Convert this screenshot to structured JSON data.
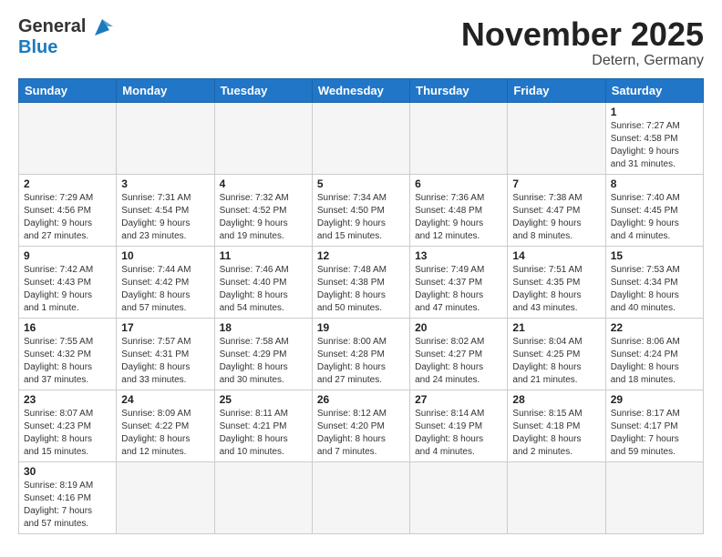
{
  "header": {
    "logo_general": "General",
    "logo_blue": "Blue",
    "month_title": "November 2025",
    "location": "Detern, Germany"
  },
  "weekdays": [
    "Sunday",
    "Monday",
    "Tuesday",
    "Wednesday",
    "Thursday",
    "Friday",
    "Saturday"
  ],
  "days": [
    {
      "num": "",
      "info": "",
      "empty": true
    },
    {
      "num": "",
      "info": "",
      "empty": true
    },
    {
      "num": "",
      "info": "",
      "empty": true
    },
    {
      "num": "",
      "info": "",
      "empty": true
    },
    {
      "num": "",
      "info": "",
      "empty": true
    },
    {
      "num": "",
      "info": "",
      "empty": true
    },
    {
      "num": "1",
      "info": "Sunrise: 7:27 AM\nSunset: 4:58 PM\nDaylight: 9 hours\nand 31 minutes.",
      "empty": false
    },
    {
      "num": "2",
      "info": "Sunrise: 7:29 AM\nSunset: 4:56 PM\nDaylight: 9 hours\nand 27 minutes.",
      "empty": false
    },
    {
      "num": "3",
      "info": "Sunrise: 7:31 AM\nSunset: 4:54 PM\nDaylight: 9 hours\nand 23 minutes.",
      "empty": false
    },
    {
      "num": "4",
      "info": "Sunrise: 7:32 AM\nSunset: 4:52 PM\nDaylight: 9 hours\nand 19 minutes.",
      "empty": false
    },
    {
      "num": "5",
      "info": "Sunrise: 7:34 AM\nSunset: 4:50 PM\nDaylight: 9 hours\nand 15 minutes.",
      "empty": false
    },
    {
      "num": "6",
      "info": "Sunrise: 7:36 AM\nSunset: 4:48 PM\nDaylight: 9 hours\nand 12 minutes.",
      "empty": false
    },
    {
      "num": "7",
      "info": "Sunrise: 7:38 AM\nSunset: 4:47 PM\nDaylight: 9 hours\nand 8 minutes.",
      "empty": false
    },
    {
      "num": "8",
      "info": "Sunrise: 7:40 AM\nSunset: 4:45 PM\nDaylight: 9 hours\nand 4 minutes.",
      "empty": false
    },
    {
      "num": "9",
      "info": "Sunrise: 7:42 AM\nSunset: 4:43 PM\nDaylight: 9 hours\nand 1 minute.",
      "empty": false
    },
    {
      "num": "10",
      "info": "Sunrise: 7:44 AM\nSunset: 4:42 PM\nDaylight: 8 hours\nand 57 minutes.",
      "empty": false
    },
    {
      "num": "11",
      "info": "Sunrise: 7:46 AM\nSunset: 4:40 PM\nDaylight: 8 hours\nand 54 minutes.",
      "empty": false
    },
    {
      "num": "12",
      "info": "Sunrise: 7:48 AM\nSunset: 4:38 PM\nDaylight: 8 hours\nand 50 minutes.",
      "empty": false
    },
    {
      "num": "13",
      "info": "Sunrise: 7:49 AM\nSunset: 4:37 PM\nDaylight: 8 hours\nand 47 minutes.",
      "empty": false
    },
    {
      "num": "14",
      "info": "Sunrise: 7:51 AM\nSunset: 4:35 PM\nDaylight: 8 hours\nand 43 minutes.",
      "empty": false
    },
    {
      "num": "15",
      "info": "Sunrise: 7:53 AM\nSunset: 4:34 PM\nDaylight: 8 hours\nand 40 minutes.",
      "empty": false
    },
    {
      "num": "16",
      "info": "Sunrise: 7:55 AM\nSunset: 4:32 PM\nDaylight: 8 hours\nand 37 minutes.",
      "empty": false
    },
    {
      "num": "17",
      "info": "Sunrise: 7:57 AM\nSunset: 4:31 PM\nDaylight: 8 hours\nand 33 minutes.",
      "empty": false
    },
    {
      "num": "18",
      "info": "Sunrise: 7:58 AM\nSunset: 4:29 PM\nDaylight: 8 hours\nand 30 minutes.",
      "empty": false
    },
    {
      "num": "19",
      "info": "Sunrise: 8:00 AM\nSunset: 4:28 PM\nDaylight: 8 hours\nand 27 minutes.",
      "empty": false
    },
    {
      "num": "20",
      "info": "Sunrise: 8:02 AM\nSunset: 4:27 PM\nDaylight: 8 hours\nand 24 minutes.",
      "empty": false
    },
    {
      "num": "21",
      "info": "Sunrise: 8:04 AM\nSunset: 4:25 PM\nDaylight: 8 hours\nand 21 minutes.",
      "empty": false
    },
    {
      "num": "22",
      "info": "Sunrise: 8:06 AM\nSunset: 4:24 PM\nDaylight: 8 hours\nand 18 minutes.",
      "empty": false
    },
    {
      "num": "23",
      "info": "Sunrise: 8:07 AM\nSunset: 4:23 PM\nDaylight: 8 hours\nand 15 minutes.",
      "empty": false
    },
    {
      "num": "24",
      "info": "Sunrise: 8:09 AM\nSunset: 4:22 PM\nDaylight: 8 hours\nand 12 minutes.",
      "empty": false
    },
    {
      "num": "25",
      "info": "Sunrise: 8:11 AM\nSunset: 4:21 PM\nDaylight: 8 hours\nand 10 minutes.",
      "empty": false
    },
    {
      "num": "26",
      "info": "Sunrise: 8:12 AM\nSunset: 4:20 PM\nDaylight: 8 hours\nand 7 minutes.",
      "empty": false
    },
    {
      "num": "27",
      "info": "Sunrise: 8:14 AM\nSunset: 4:19 PM\nDaylight: 8 hours\nand 4 minutes.",
      "empty": false
    },
    {
      "num": "28",
      "info": "Sunrise: 8:15 AM\nSunset: 4:18 PM\nDaylight: 8 hours\nand 2 minutes.",
      "empty": false
    },
    {
      "num": "29",
      "info": "Sunrise: 8:17 AM\nSunset: 4:17 PM\nDaylight: 7 hours\nand 59 minutes.",
      "empty": false
    },
    {
      "num": "30",
      "info": "Sunrise: 8:19 AM\nSunset: 4:16 PM\nDaylight: 7 hours\nand 57 minutes.",
      "empty": false,
      "last": true
    },
    {
      "num": "",
      "info": "",
      "empty": true,
      "last": true
    },
    {
      "num": "",
      "info": "",
      "empty": true,
      "last": true
    },
    {
      "num": "",
      "info": "",
      "empty": true,
      "last": true
    },
    {
      "num": "",
      "info": "",
      "empty": true,
      "last": true
    },
    {
      "num": "",
      "info": "",
      "empty": true,
      "last": true
    },
    {
      "num": "",
      "info": "",
      "empty": true,
      "last": true
    }
  ]
}
